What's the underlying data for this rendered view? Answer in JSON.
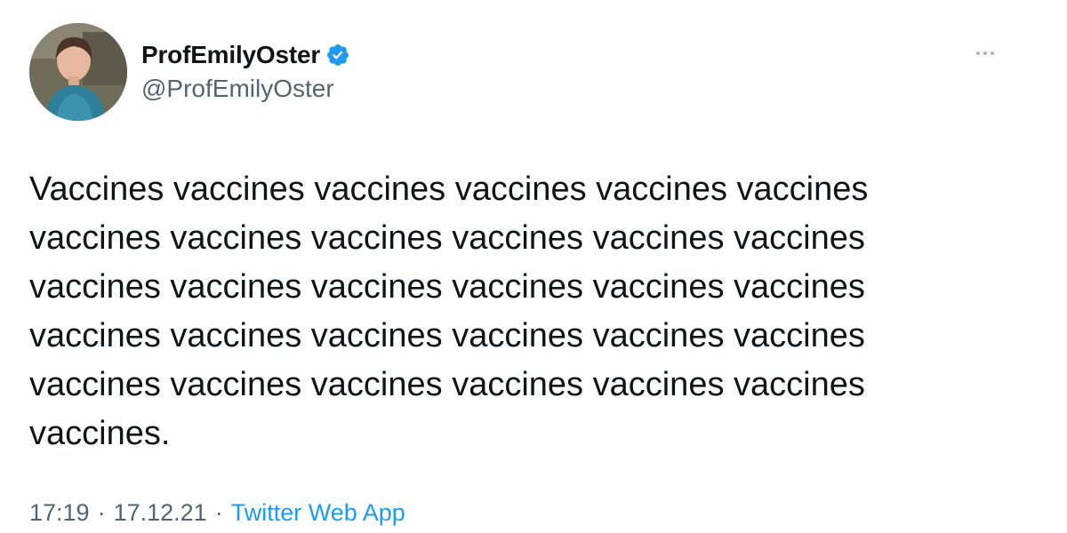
{
  "author": {
    "display_name": "ProfEmilyOster",
    "handle": "@ProfEmilyOster",
    "verified": true,
    "avatar_icon": "profile-photo"
  },
  "tweet": {
    "text": "Vaccines vaccines vaccines vaccines vaccines vaccines vaccines vaccines vaccines vaccines vaccines vaccines vaccines vaccines vaccines vaccines vaccines vaccines vaccines vaccines vaccines vaccines vaccines vaccines vaccines vaccines vaccines vaccines vaccines vaccines vaccines."
  },
  "meta": {
    "time": "17:19",
    "separator": "·",
    "date": "17.12.21",
    "source": "Twitter Web App"
  },
  "colors": {
    "text": "#0f1419",
    "secondary": "#536471",
    "link": "#1d9bf0",
    "verified_badge": "#1d9bf0",
    "more_dots": "#a8b3bb"
  },
  "icons": {
    "verified": "verified-badge-icon",
    "more": "more-options-icon"
  }
}
